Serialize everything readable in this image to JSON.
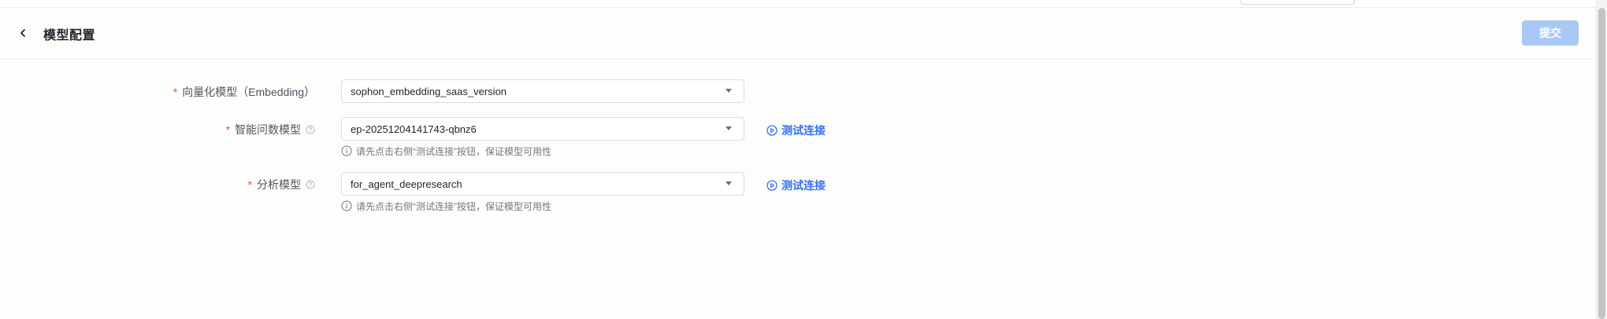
{
  "header": {
    "title": "模型配置",
    "submit_label": "提交"
  },
  "form": {
    "embedding": {
      "label": "向量化模型（Embedding）",
      "value": "sophon_embedding_saas_version"
    },
    "qa_model": {
      "label": "智能问数模型",
      "value": "ep-20251204141743-qbnz6",
      "test_label": "测试连接",
      "hint": "请先点击右侧“测试连接”按钮，保证模型可用性"
    },
    "analysis_model": {
      "label": "分析模型",
      "value": "for_agent_deepresearch",
      "test_label": "测试连接",
      "hint": "请先点击右侧“测试连接”按钮，保证模型可用性"
    }
  },
  "icons": {
    "back": "chevron-left-icon",
    "help": "question-circle-icon",
    "dropdown": "caret-down-icon",
    "test": "play-circle-icon",
    "info": "info-circle-icon"
  },
  "colors": {
    "accent": "#3370ff",
    "submit_disabled": "#a9c9f5",
    "required": "#f54a45"
  }
}
